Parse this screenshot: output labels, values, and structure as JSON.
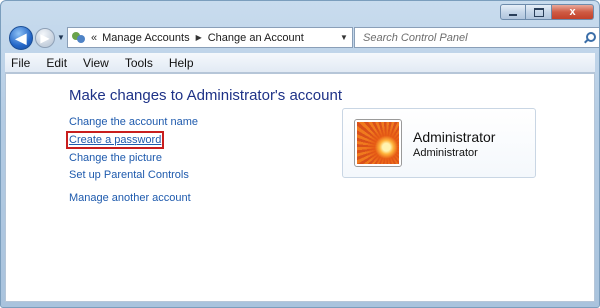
{
  "window": {
    "caption_buttons": {
      "minimize": "",
      "maximize": "",
      "close": "x"
    }
  },
  "nav": {
    "back_glyph": "◀",
    "forward_glyph": "▶",
    "address": {
      "overflow": "«",
      "crumbs": [
        "Manage Accounts",
        "Change an Account"
      ]
    },
    "refresh_glyph": "↻",
    "search_placeholder": "Search Control Panel"
  },
  "menu": [
    "File",
    "Edit",
    "View",
    "Tools",
    "Help"
  ],
  "main": {
    "title": "Make changes to Administrator's account",
    "links": [
      "Change the account name",
      "Create a password",
      "Change the picture",
      "Set up Parental Controls"
    ],
    "manage_link": "Manage another account",
    "highlighted_link_index": 1
  },
  "account": {
    "name": "Administrator",
    "type": "Administrator"
  },
  "colors": {
    "link": "#1e5aad",
    "title": "#1e3287",
    "highlight_box": "#c81e1e"
  }
}
